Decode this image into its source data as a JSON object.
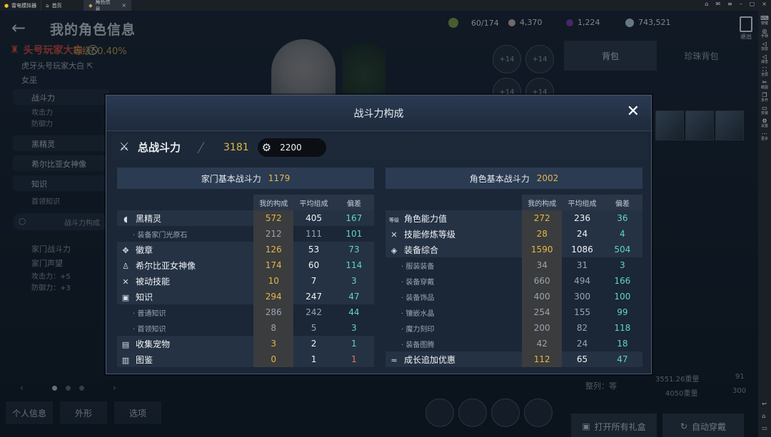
{
  "window": {
    "tabs": [
      {
        "label": "雷电模拟器"
      },
      {
        "label": "首页"
      },
      {
        "label": "角色信息"
      }
    ]
  },
  "sidebar": {
    "items": [
      {
        "label": "按键",
        "icon": "keyboard-icon"
      },
      {
        "label": "手柄",
        "icon": "gamepad-icon"
      },
      {
        "label": "加音",
        "icon": "volume-up-icon"
      },
      {
        "label": "减音",
        "icon": "volume-down-icon"
      },
      {
        "label": "全屏",
        "icon": "fullscreen-icon"
      },
      {
        "label": "截图",
        "icon": "scissors-icon"
      },
      {
        "label": "多开",
        "icon": "multi-icon"
      },
      {
        "label": "安装",
        "icon": "install-icon"
      },
      {
        "label": "设置",
        "icon": "gear-icon"
      },
      {
        "label": "更多",
        "icon": "more-icon"
      }
    ]
  },
  "header": {
    "title": "我的角色信息",
    "exit_label": "退出"
  },
  "currencies": [
    {
      "value": "60/174",
      "icon": "stamina-icon",
      "color": "#7fa04a"
    },
    {
      "value": "4,370",
      "icon": "pearl-icon",
      "color": "#c9b7b3"
    },
    {
      "value": "1,224",
      "icon": "amethyst-icon",
      "color": "#7a3fb0"
    },
    {
      "value": "743,521",
      "icon": "silver-icon",
      "color": "#b8d4e6"
    }
  ],
  "profile": {
    "name": "头号玩家大白",
    "family": "虎牙头号玩家大白",
    "class": "女巫",
    "level": "等级50.40%"
  },
  "left_nav": {
    "combat": "战斗力",
    "attack": "攻击力",
    "defense": "防御力",
    "black_spirit": "黑精灵",
    "goddess": "希尔比亚女神像",
    "knowledge": "知识",
    "first_knowledge": "首领知识",
    "search": "战斗力构成",
    "family_combat": "家门战斗力",
    "family_fame": "家门声望",
    "attack_bonus": "攻击力：+5",
    "defense_bonus": "防御力：+3"
  },
  "bottom_tabs": [
    "个人信息",
    "外形",
    "选项"
  ],
  "right_panel": {
    "tabs": [
      "背包",
      "珍珠背包"
    ],
    "sort_label": "整列：等",
    "weight_current": "3551.26重量",
    "weight_max": "4050重量",
    "slot_count": "91",
    "slot_max": "300",
    "open_gifts": "打开所有礼盒",
    "auto_equip": "自动穿戴"
  },
  "modal": {
    "title": "战斗力构成",
    "total_label": "总战斗力",
    "total_value": "3181",
    "gear_value": "2200",
    "headers": {
      "mine": "我的构成",
      "avg": "平均组成",
      "diff": "偏差"
    },
    "family": {
      "title": "家门基本战斗力",
      "value": "1179",
      "rows": [
        {
          "name": "黑精灵",
          "mine": "572",
          "avg": "405",
          "diff": "167",
          "main": true,
          "icon": "black-spirit-icon",
          "glyph": "◖"
        },
        {
          "name": "· 装备家门光原石",
          "mine": "212",
          "avg": "111",
          "diff": "101",
          "main": false
        },
        {
          "name": "徽章",
          "mine": "126",
          "avg": "53",
          "diff": "73",
          "main": true,
          "icon": "emblem-icon",
          "glyph": "✥"
        },
        {
          "name": "希尔比亚女神像",
          "mine": "174",
          "avg": "60",
          "diff": "114",
          "main": true,
          "icon": "goddess-icon",
          "glyph": "♙"
        },
        {
          "name": "被动技能",
          "mine": "10",
          "avg": "7",
          "diff": "3",
          "main": true,
          "icon": "skill-icon",
          "glyph": "✕"
        },
        {
          "name": "知识",
          "mine": "294",
          "avg": "247",
          "diff": "47",
          "main": true,
          "icon": "knowledge-icon",
          "glyph": "▣"
        },
        {
          "name": "· 普通知识",
          "mine": "286",
          "avg": "242",
          "diff": "44",
          "main": false
        },
        {
          "name": "· 首领知识",
          "mine": "8",
          "avg": "5",
          "diff": "3",
          "main": false
        },
        {
          "name": "收集宠物",
          "mine": "3",
          "avg": "2",
          "diff": "1",
          "main": true,
          "icon": "pet-icon",
          "glyph": "▤"
        },
        {
          "name": "图鉴",
          "mine": "0",
          "avg": "1",
          "diff": "1",
          "main": true,
          "icon": "codex-icon",
          "glyph": "▥",
          "neg": true
        }
      ]
    },
    "character": {
      "title": "角色基本战斗力",
      "value": "2002",
      "rows": [
        {
          "name": "角色能力值",
          "mine": "272",
          "avg": "236",
          "diff": "36",
          "main": true,
          "icon": "level-icon",
          "glyph": "等级"
        },
        {
          "name": "技能修炼等级",
          "mine": "28",
          "avg": "24",
          "diff": "4",
          "main": true,
          "icon": "skill-train-icon",
          "glyph": "✕"
        },
        {
          "name": "装备综合",
          "mine": "1590",
          "avg": "1086",
          "diff": "504",
          "main": true,
          "icon": "equipment-icon",
          "glyph": "◈"
        },
        {
          "name": "· 服装装备",
          "mine": "34",
          "avg": "31",
          "diff": "3",
          "main": false
        },
        {
          "name": "· 装备穿戴",
          "mine": "660",
          "avg": "494",
          "diff": "166",
          "main": false
        },
        {
          "name": "· 装备饰品",
          "mine": "400",
          "avg": "300",
          "diff": "100",
          "main": false
        },
        {
          "name": "· 镶嵌水晶",
          "mine": "254",
          "avg": "155",
          "diff": "99",
          "main": false
        },
        {
          "name": "· 魔力刻印",
          "mine": "200",
          "avg": "82",
          "diff": "118",
          "main": false
        },
        {
          "name": "· 装备图腾",
          "mine": "42",
          "avg": "24",
          "diff": "18",
          "main": false
        },
        {
          "name": "成长追加优惠",
          "mine": "112",
          "avg": "65",
          "diff": "47",
          "main": true,
          "icon": "growth-icon",
          "glyph": "≈"
        }
      ]
    }
  }
}
